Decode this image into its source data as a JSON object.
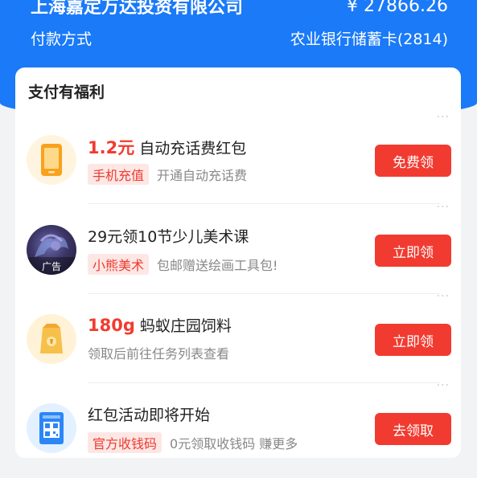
{
  "header": {
    "payee": "上海嘉定万达投资有限公司",
    "amount": "¥ 27866.26",
    "pay_method_label": "付款方式",
    "pay_method_value": "农业银行储蓄卡(2814)"
  },
  "benefits": {
    "title": "支付有福利",
    "more": "···",
    "items": [
      {
        "highlight": "1.2元",
        "title": "自动充话费红包",
        "tag": "手机充值",
        "desc": "开通自动充话费",
        "button": "免费领",
        "icon": "phone-icon"
      },
      {
        "highlight": "",
        "title": "29元领10节少儿美术课",
        "tag": "小熊美术",
        "desc": "包邮赠送绘画工具包!",
        "button": "立即领",
        "icon": "art-ad-image",
        "ad_label": "广告"
      },
      {
        "highlight": "180g",
        "title": "蚂蚁庄园饲料",
        "tag": "",
        "desc": "领取后前往任务列表查看",
        "button": "立即领",
        "icon": "feed-bag-icon"
      },
      {
        "highlight": "",
        "title": "红包活动即将开始",
        "tag": "官方收钱码",
        "desc": "0元领取收钱码 赚更多",
        "button": "去领取",
        "icon": "qr-code-icon"
      }
    ]
  },
  "colors": {
    "brand_blue": "#1a7af8",
    "accent_red": "#f23b30"
  }
}
